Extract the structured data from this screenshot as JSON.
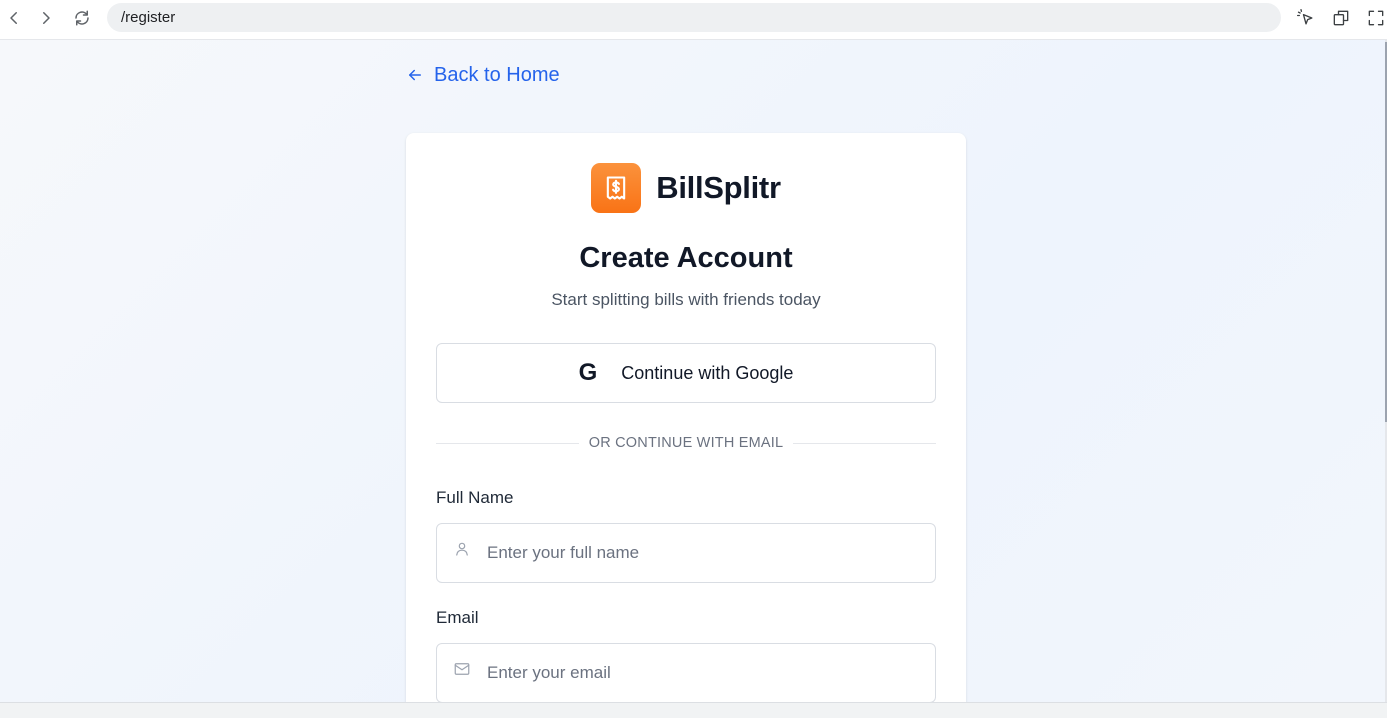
{
  "browser": {
    "url": "/register",
    "icons": {
      "back": "chevron-left-icon",
      "forward": "chevron-right-icon",
      "reload": "reload-icon",
      "pointer": "cursor-select-icon",
      "windows": "copy-window-icon",
      "fullscreen": "fullscreen-icon"
    }
  },
  "page": {
    "back_link": "Back to Home",
    "brand": {
      "name": "BillSplitr",
      "logo_icon": "receipt-dollar-icon",
      "logo_color": "#f97316"
    },
    "title": "Create Account",
    "subtitle": "Start splitting bills with friends today",
    "google_button": "Continue with Google",
    "divider_text": "OR CONTINUE WITH EMAIL",
    "fields": [
      {
        "label": "Full Name",
        "placeholder": "Enter your full name",
        "icon": "user-icon"
      },
      {
        "label": "Email",
        "placeholder": "Enter your email",
        "icon": "mail-icon"
      }
    ]
  },
  "colors": {
    "accent": "#2563eb",
    "brand": "#f97316",
    "text": "#111827",
    "muted": "#6b7280"
  }
}
